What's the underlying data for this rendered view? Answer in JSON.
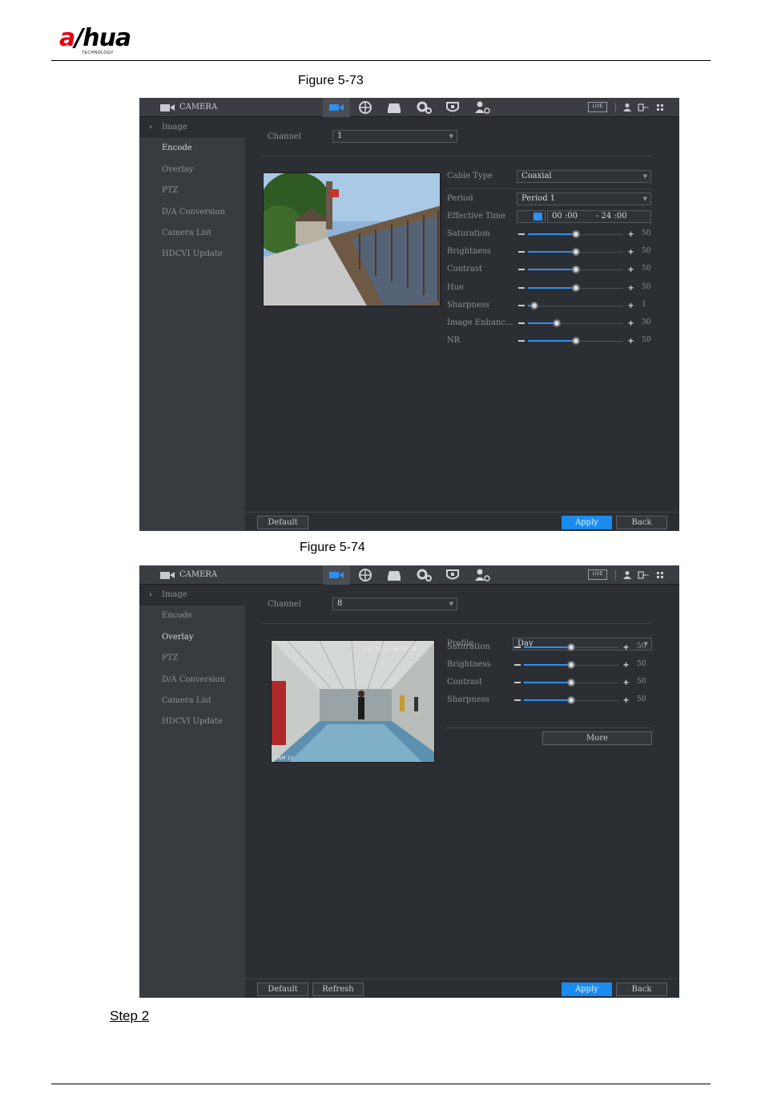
{
  "header": {
    "logo_text": "alhua",
    "logo_subtext": "TECHNOLOGY"
  },
  "figure1": {
    "caption": "Figure 5-73",
    "app_title": "CAMERA",
    "live_label": "LIVE",
    "menu": [
      "Image",
      "Encode",
      "Overlay",
      "PTZ",
      "D/A Conversion",
      "Camera List",
      "HDCVI Update"
    ],
    "selected_menu": "Image",
    "channel_label": "Channel",
    "channel_value": "1",
    "cable_type_label": "Cable Type",
    "cable_type_value": "Coaxial",
    "period_label": "Period",
    "period_value": "Period 1",
    "effective_time_label": "Effective Time",
    "time_start": "00 :00",
    "time_end": "- 24 :00",
    "sliders": [
      {
        "label": "Saturation",
        "value": 50,
        "max": 100,
        "display": "50"
      },
      {
        "label": "Brightness",
        "value": 50,
        "max": 100,
        "display": "50"
      },
      {
        "label": "Contrast",
        "value": 50,
        "max": 100,
        "display": "50"
      },
      {
        "label": "Hue",
        "value": 50,
        "max": 100,
        "display": "50"
      },
      {
        "label": "Sharpness",
        "value": 1,
        "max": 15,
        "display": "1"
      },
      {
        "label": "Image Enhanc...",
        "value": 30,
        "max": 100,
        "display": "30"
      },
      {
        "label": "NR",
        "value": 50,
        "max": 100,
        "display": "50"
      }
    ],
    "buttons": {
      "default": "Default",
      "apply": "Apply",
      "back": "Back"
    }
  },
  "figure2": {
    "caption": "Figure 5-74",
    "app_title": "CAMERA",
    "live_label": "LIVE",
    "menu": [
      "Image",
      "Encode",
      "Overlay",
      "PTZ",
      "D/A Conversion",
      "Camera List",
      "HDCVI Update"
    ],
    "selected_menu": "Image",
    "channel_label": "Channel",
    "channel_value": "8",
    "profile_label": "Profile",
    "profile_value": "Day",
    "preview_timestamp": "2017-11-01 09:59:36",
    "preview_cam_label": "CAM 10",
    "sliders": [
      {
        "label": "Saturation",
        "value": 50,
        "max": 100,
        "display": "50"
      },
      {
        "label": "Brightness",
        "value": 50,
        "max": 100,
        "display": "50"
      },
      {
        "label": "Contrast",
        "value": 50,
        "max": 100,
        "display": "50"
      },
      {
        "label": "Sharpness",
        "value": 50,
        "max": 100,
        "display": "50"
      }
    ],
    "more_label": "More",
    "buttons": {
      "default": "Default",
      "refresh": "Refresh",
      "apply": "Apply",
      "back": "Back"
    }
  },
  "step_label": "Step 2",
  "colors": {
    "accent": "#1a8cf0",
    "window_bg": "#2b2e33",
    "sidebar_bg": "#383b40",
    "logo_red": "#e60012"
  }
}
